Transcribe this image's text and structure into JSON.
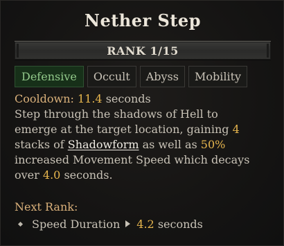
{
  "skill": {
    "name": "Nether Step",
    "rank": "RANK 1/15"
  },
  "tags": [
    {
      "label": "Defensive",
      "active": true
    },
    {
      "label": "Occult",
      "active": false
    },
    {
      "label": "Abyss",
      "active": false
    },
    {
      "label": "Mobility",
      "active": false
    }
  ],
  "cooldown": {
    "label": "Cooldown:",
    "value": "11.4",
    "unit": "seconds"
  },
  "description": {
    "line1": "Step through the shadows of Hell to",
    "line2_a": "emerge at the target location, gaining",
    "line2_val": "4",
    "line3_a": "stacks of",
    "line3_link": "Shadowform",
    "line3_b": "as well as",
    "line3_val": "50%",
    "line4": "increased Movement Speed which decays",
    "line5_a": "over",
    "line5_val": "4.0",
    "line5_b": "seconds."
  },
  "next_rank": {
    "label": "Next Rank:",
    "stat_label": "Speed Duration",
    "stat_value": "4.2",
    "stat_unit": "seconds"
  },
  "colors": {
    "accent_orange": "#e7b64e",
    "tag_active_text": "#92c98a",
    "tag_active_bg": "#173019"
  }
}
